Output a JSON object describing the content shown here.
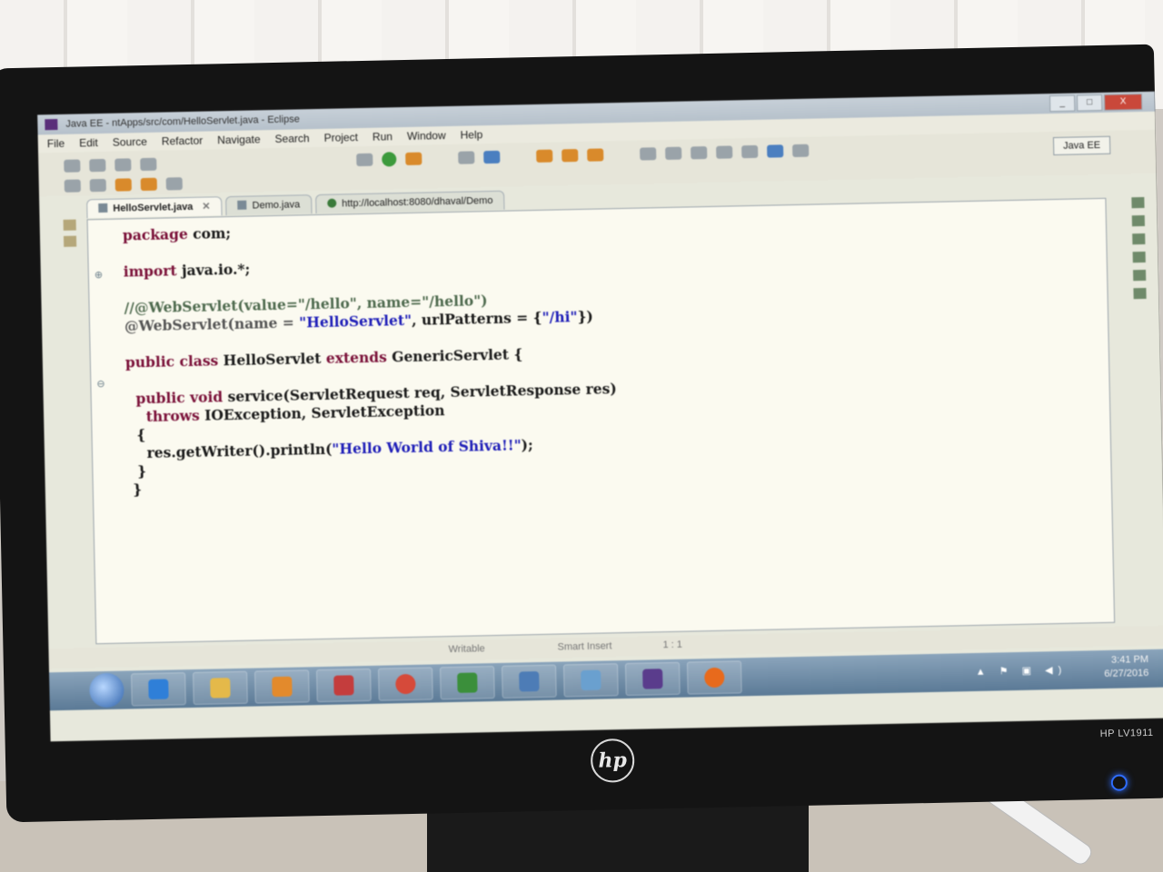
{
  "window": {
    "title": "Java EE - ntApps/src/com/HelloServlet.java - Eclipse",
    "controls": [
      "_",
      "□",
      "X"
    ]
  },
  "menu": [
    "File",
    "Edit",
    "Source",
    "Refactor",
    "Navigate",
    "Search",
    "Project",
    "Run",
    "Window",
    "Help"
  ],
  "perspective": "Java EE",
  "tabs": [
    {
      "label": "HelloServlet.java",
      "active": true,
      "close": "✕"
    },
    {
      "label": "Demo.java",
      "active": false
    },
    {
      "label": "http://localhost:8080/dhaval/Demo",
      "active": false
    }
  ],
  "code": {
    "l1": {
      "kw": "package",
      "rest": " com;"
    },
    "l2": {
      "kw": "import",
      "rest": " java.io.*;"
    },
    "l3": "//@WebServlet(value=\"/hello\", name=\"/hello\")",
    "l4": {
      "pre": "@WebServlet(name = ",
      "s1": "\"HelloServlet\"",
      "mid": ", urlPatterns = {",
      "s2": "\"/hi\"",
      "post": "})"
    },
    "l5": {
      "kw1": "public",
      "kw2": "class",
      "name": " HelloServlet ",
      "kw3": "extends",
      "rest": " GenericServlet {"
    },
    "l6": {
      "kw1": "public",
      "kw2": "void",
      "rest": " service(ServletRequest req, ServletResponse res)"
    },
    "l7": {
      "kw": "throws",
      "rest": " IOException, ServletException"
    },
    "l8": "{",
    "l9": {
      "pre": "res.getWriter().println(",
      "str": "\"Hello World of Shiva!!\"",
      "post": ");"
    },
    "l10": "}",
    "l11": "}"
  },
  "status": {
    "writable": "Writable",
    "insert": "Smart Insert",
    "position": "1 : 1"
  },
  "taskbar": {
    "time": "3:41 PM",
    "date": "6/27/2016"
  },
  "monitor": {
    "model": "HP LV1911",
    "logo": "hp"
  }
}
